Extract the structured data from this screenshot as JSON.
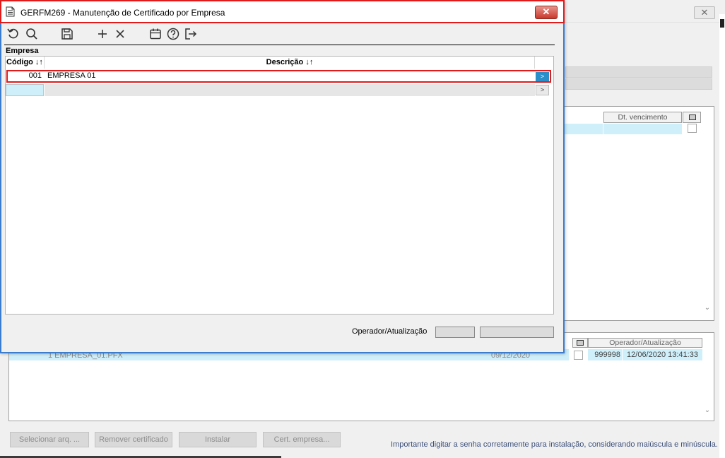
{
  "background": {
    "columns": {
      "due_date": "Dt. vencimento",
      "operator_update": "Operador/Atualização"
    },
    "row": {
      "text": "1  EMPRESA_01.PFX",
      "date": "09/12/2020",
      "operator": "999998",
      "timestamp": "12/06/2020 13:41:33"
    },
    "buttons": {
      "select_file": "Selecionar arq. ...",
      "remove_certificate": "Remover certificado",
      "install": "Instalar",
      "company_cert": "Cert. empresa..."
    },
    "hint": "Importante digitar a senha corretamente para instalação, considerando maiúscula e minúscula.",
    "close_glyph": "✕"
  },
  "dialog": {
    "title": "GERFM269 - Manutenção de Certificado por Empresa",
    "close_glyph": "✕",
    "toolbar_icons": [
      "refresh-icon",
      "search-icon",
      "save-icon",
      "add-icon",
      "delete-icon",
      "calendar-icon",
      "help-icon",
      "exit-icon"
    ],
    "section_label": "Empresa",
    "columns": {
      "code": "Código ↓↑",
      "description": "Descrição ↓↑"
    },
    "rows": [
      {
        "code": "001",
        "description": "EMPRESA 01",
        "button": ">"
      }
    ],
    "new_row_button": ">",
    "footer_label": "Operador/Atualização"
  },
  "colors": {
    "title_highlight": "#e01b1b",
    "selected_row_bg": "#cfeffa",
    "row_button": "#2a8fc9",
    "dialog_border": "#3a7cd0"
  }
}
